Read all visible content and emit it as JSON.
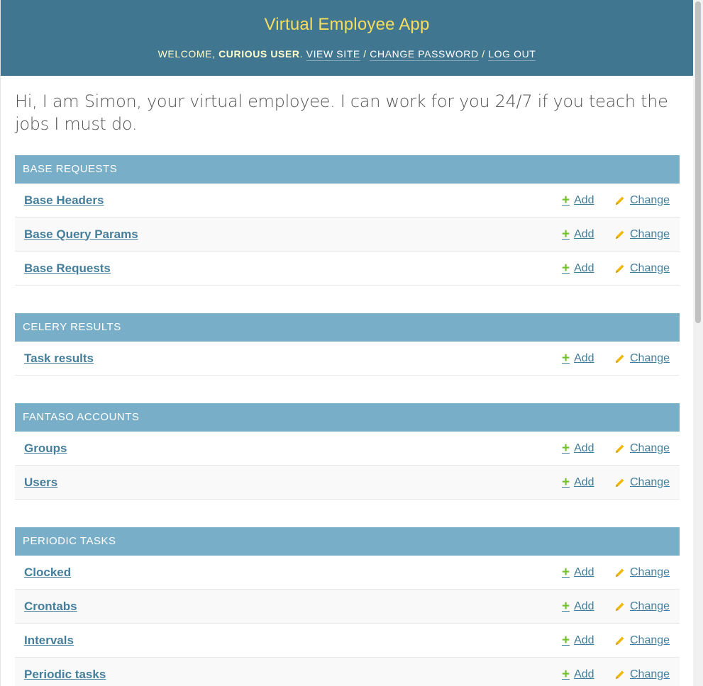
{
  "header": {
    "title": "Virtual Employee App",
    "welcome": "WELCOME, ",
    "username": "CURIOUS USER",
    "period": ". ",
    "links": [
      "VIEW SITE",
      "CHANGE PASSWORD",
      "LOG OUT"
    ],
    "separator": " / "
  },
  "intro": "Hi, I am Simon, your virtual employee. I can work for you 24/7 if you teach the jobs I must do.",
  "actions": {
    "add": "Add",
    "change": "Change"
  },
  "modules": [
    {
      "caption": "BASE REQUESTS",
      "models": [
        "Base Headers",
        "Base Query Params",
        "Base Requests"
      ]
    },
    {
      "caption": "CELERY RESULTS",
      "models": [
        "Task results"
      ]
    },
    {
      "caption": "FANTASO ACCOUNTS",
      "models": [
        "Groups",
        "Users"
      ]
    },
    {
      "caption": "PERIODIC TASKS",
      "models": [
        "Clocked",
        "Crontabs",
        "Intervals",
        "Periodic tasks"
      ]
    }
  ],
  "colors": {
    "header_bg": "#417690",
    "title": "#f5dd5d",
    "caption_bg": "#79aec8",
    "link": "#447e9b",
    "add_icon": "#70bf2b",
    "change_icon": "#efb80b"
  },
  "icons": {
    "add": "plus-icon",
    "change": "pencil-icon"
  }
}
